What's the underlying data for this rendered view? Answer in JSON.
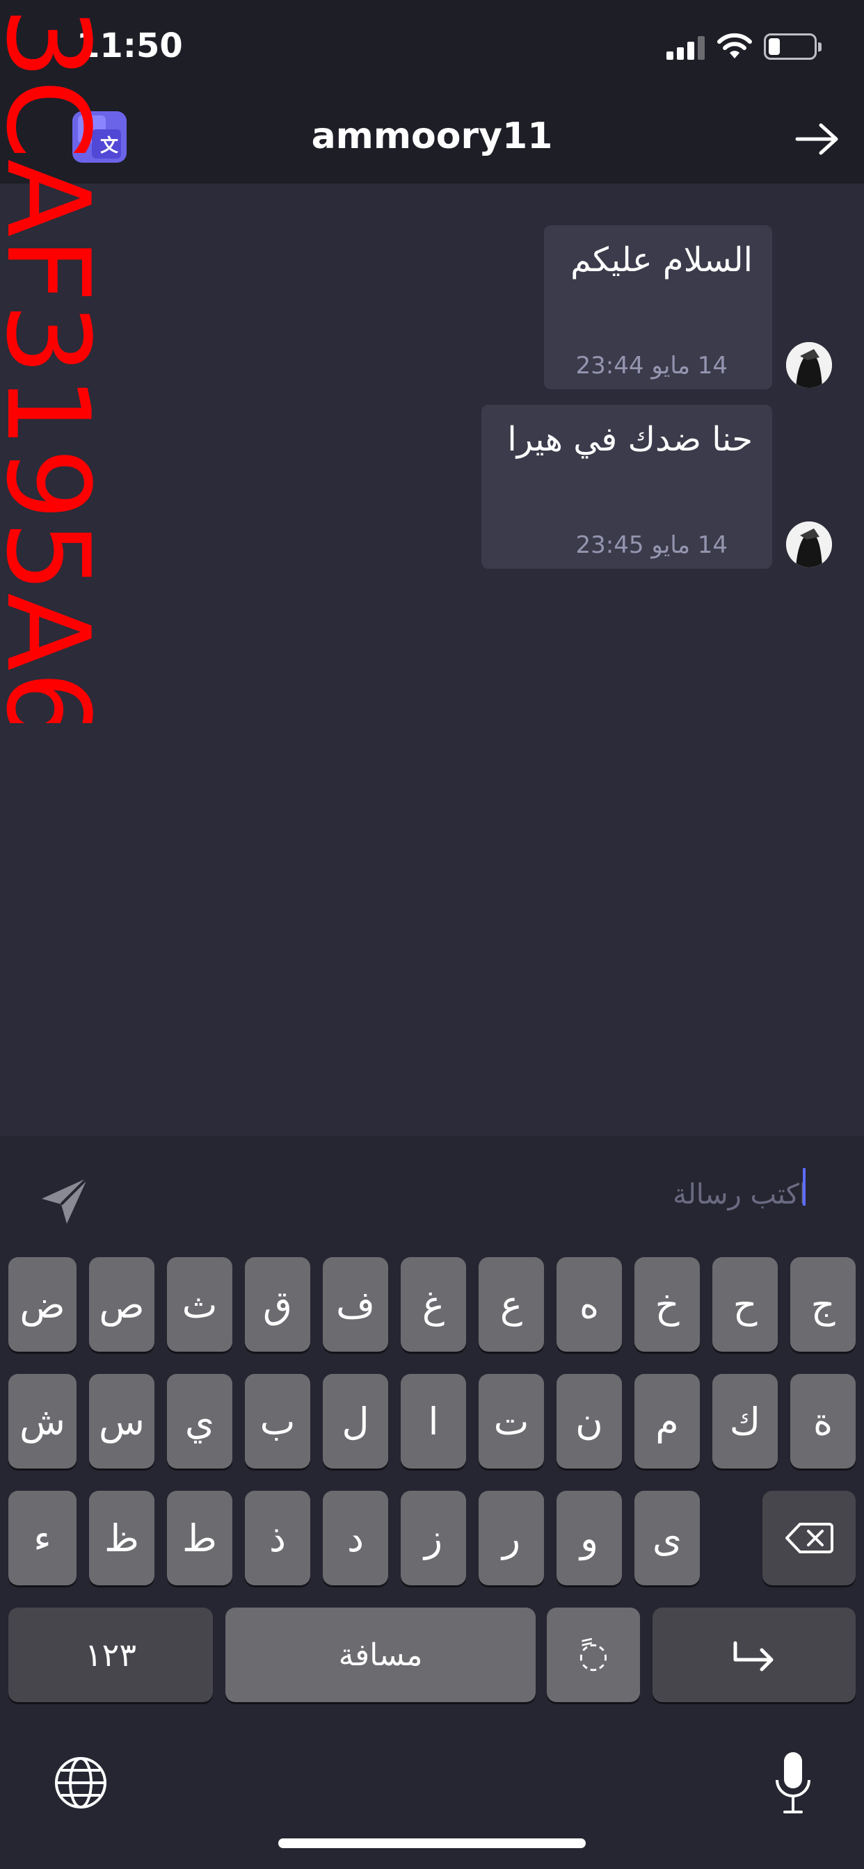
{
  "status_bar": {
    "time": "11:50"
  },
  "header": {
    "title": "ammoory11",
    "translate_icon": "translate-icon",
    "back_icon": "right-arrow-icon"
  },
  "messages": [
    {
      "text": "السلام عليكم",
      "time": "14 مايو 23:44"
    },
    {
      "text": "حنا ضدك في هيرا",
      "time": "14 مايو 23:45"
    }
  ],
  "composer": {
    "placeholder": "اكتب رسالة",
    "value": ""
  },
  "keyboard": {
    "row1": [
      "ض",
      "ص",
      "ث",
      "ق",
      "ف",
      "غ",
      "ع",
      "ه",
      "خ",
      "ح",
      "ج"
    ],
    "row2": [
      "ش",
      "س",
      "ي",
      "ب",
      "ل",
      "ا",
      "ت",
      "ن",
      "م",
      "ك",
      "ة"
    ],
    "row3": [
      "ء",
      "ظ",
      "ط",
      "ذ",
      "د",
      "ز",
      "ر",
      "و",
      "ى"
    ],
    "numbers_label": "١٢٣",
    "space_label": "مسافة",
    "diacritic_label": "ً◌"
  },
  "watermark": "3CAF3195A6",
  "colors": {
    "accent": "#6c64e8",
    "watermark": "#ff0000",
    "bubble": "#3b3b4b",
    "chat_bg": "#2b2b39"
  }
}
